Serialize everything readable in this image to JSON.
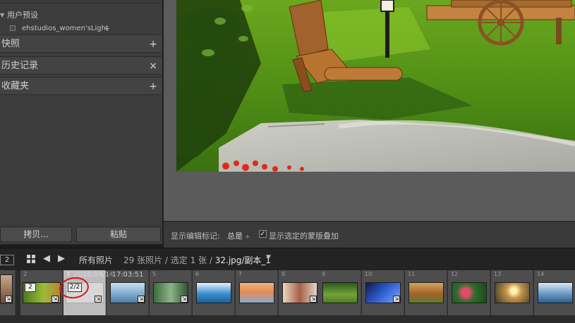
{
  "left_panel": {
    "presets_group": {
      "label": "用户预设",
      "item": "ehstudios_women'sLight",
      "item_action": "+"
    },
    "sections": [
      {
        "label": "快照",
        "action": "+"
      },
      {
        "label": "历史记录",
        "action": "×"
      },
      {
        "label": "收藏夹",
        "action": "+"
      }
    ],
    "copy_button": "拷贝...",
    "paste_button": "粘贴"
  },
  "toolbar": {
    "show_edit_pins_label": "显示编辑标记:",
    "show_edit_pins_value": "总是",
    "show_mask_label": "显示选定的蒙版叠加",
    "show_mask_checked": true
  },
  "filmstrip_bar": {
    "page": "2",
    "source": "所有照片",
    "photo_count": "29 张照片 /",
    "selected_count": "选定 1 张 /",
    "filename": "32.jpg/副本_1"
  },
  "filmstrip": {
    "selected_index": 3,
    "stack_badge_cell2": "2",
    "stack_badge_cell3": "2/2",
    "ghost_text": "2018/04/1 17:03:51"
  },
  "colors": {
    "panel": "#3c3c3c",
    "main_bg": "#5b5b5b",
    "filmstrip_bg": "#2b2b2b",
    "selected_cell": "#bdbdbd",
    "annotation_circle": "#d9141a"
  }
}
